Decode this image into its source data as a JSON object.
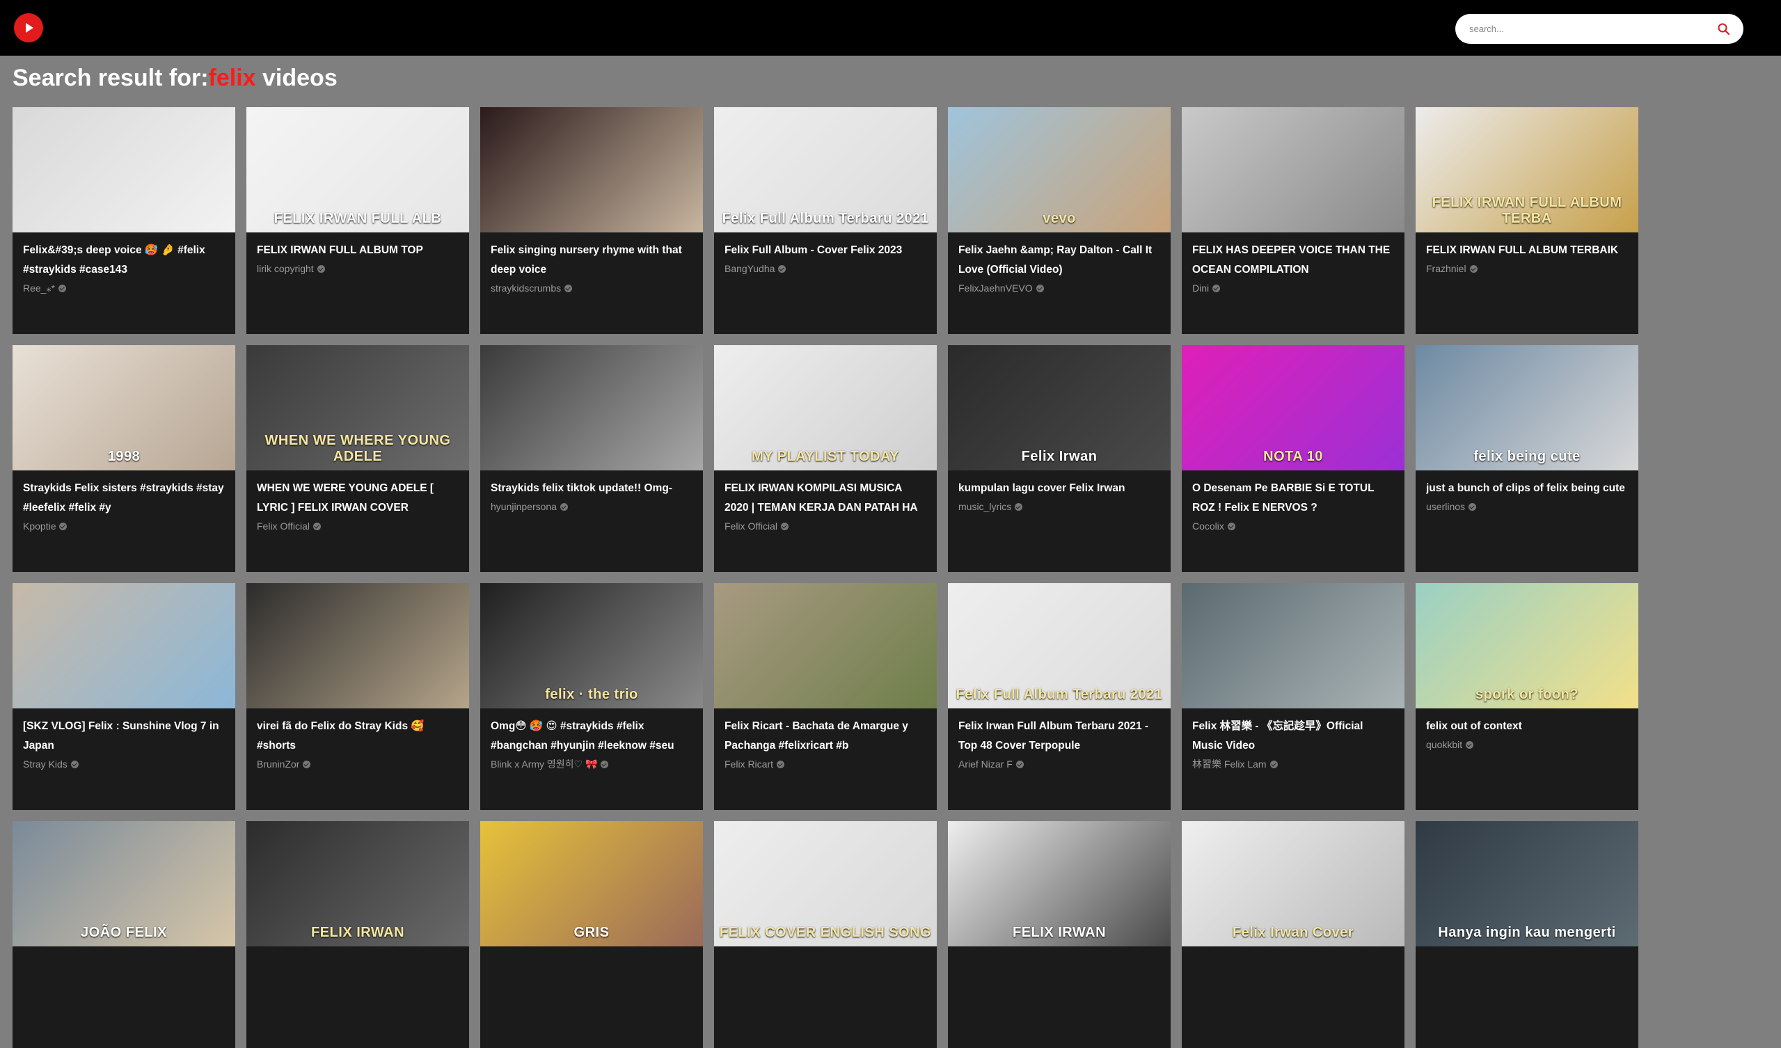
{
  "header": {
    "logo_icon": "play-logo-icon",
    "search_placeholder": "search...",
    "search_icon": "search-icon"
  },
  "heading": {
    "prefix": "Search result for:",
    "query": "felix",
    "suffix": " videos"
  },
  "videos": [
    {
      "title": "Felix&#39;s deep voice 🥵 🤌 #felix #straykids #case143",
      "channel": "Ree_⁎*",
      "thumb_colors": [
        "#d9d9d9",
        "#f2f2f2"
      ]
    },
    {
      "title": "FELIX IRWAN FULL ALBUM TOP",
      "channel": "lirik copyright",
      "thumb_colors": [
        "#f4f4f4",
        "#e6e6e6"
      ],
      "thumb_text": "FELIX IRWAN FULL ALB"
    },
    {
      "title": "Felix singing nursery rhyme with that deep voice",
      "channel": "straykidscrumbs",
      "thumb_colors": [
        "#2a1a1a",
        "#c8b6a0"
      ]
    },
    {
      "title": "Felix Full Album - Cover Felix 2023",
      "channel": "BangYudha",
      "thumb_colors": [
        "#eeeeee",
        "#dcdcdc"
      ],
      "thumb_text": "Felix Full Album Terbaru 2021"
    },
    {
      "title": "Felix Jaehn &amp; Ray Dalton - Call It Love (Official Video)",
      "channel": "FelixJaehnVEVO",
      "thumb_colors": [
        "#9fc4dc",
        "#c9a37a"
      ],
      "thumb_text": "vevo"
    },
    {
      "title": "FELIX HAS DEEPER VOICE THAN THE OCEAN COMPILATION",
      "channel": "Dini",
      "thumb_colors": [
        "#c9c9c9",
        "#8a8a8a"
      ]
    },
    {
      "title": "FELIX IRWAN FULL ALBUM TERBAIK",
      "channel": "Frazhniel",
      "thumb_colors": [
        "#ececec",
        "#c7a04a"
      ],
      "thumb_text": "FELIX IRWAN FULL ALBUM TERBA"
    },
    {
      "title": "Straykids Felix sisters #straykids #stay #leefelix #felix #y",
      "channel": "Kpoptie",
      "thumb_colors": [
        "#e8e0d6",
        "#b7a693"
      ],
      "thumb_text": "1998"
    },
    {
      "title": "WHEN WE WERE YOUNG ADELE [ LYRIC ] FELIX IRWAN COVER",
      "channel": "Felix Official",
      "thumb_colors": [
        "#3a3a3a",
        "#6d6d6d"
      ],
      "thumb_text": "WHEN WE WHERE YOUNG ADELE"
    },
    {
      "title": "Straykids felix tiktok update!! Omg-",
      "channel": "hyunjinpersona",
      "thumb_colors": [
        "#3b3b3b",
        "#a8a8a8"
      ]
    },
    {
      "title": "FELIX IRWAN KOMPILASI MUSICA 2020 | TEMAN KERJA DAN PATAH HA",
      "channel": "Felix Official",
      "thumb_colors": [
        "#eeeeee",
        "#cfcfcf"
      ],
      "thumb_text": "MY PLAYLIST TODAY"
    },
    {
      "title": "kumpulan lagu cover Felix Irwan",
      "channel": "music_lyrics",
      "thumb_colors": [
        "#2a2a2a",
        "#4a4a4a"
      ],
      "thumb_text": "Felix Irwan"
    },
    {
      "title": "O Desenam Pe BARBIE Si E TOTUL ROZ ! Felix E NERVOS ?",
      "channel": "Cocolix",
      "thumb_colors": [
        "#e01fb8",
        "#9b30d6"
      ],
      "thumb_text": "NOTA 10"
    },
    {
      "title": "just a bunch of clips of felix being cute",
      "channel": "userlinos",
      "thumb_colors": [
        "#6d8aa3",
        "#d8d8d8"
      ],
      "thumb_text": "felix being cute"
    },
    {
      "title": "[SKZ VLOG] Felix : Sunshine Vlog 7 in Japan",
      "channel": "Stray Kids",
      "thumb_colors": [
        "#c7b9a8",
        "#8cb7d8"
      ]
    },
    {
      "title": "virei fã do Felix do Stray Kids 🥰 #shorts",
      "channel": "BruninZor",
      "thumb_colors": [
        "#2c2c2c",
        "#b5a58a"
      ]
    },
    {
      "title": "Omg😳 🥵 😍 #straykids #felix #bangchan #hyunjin #leeknow #seu",
      "channel": "Blink x Army 영원히♡ 🎀",
      "thumb_colors": [
        "#1f1f1f",
        "#8a8a8a"
      ],
      "thumb_text": "felix · the trio"
    },
    {
      "title": "Felix Ricart - Bachata de Amargue y Pachanga #felixricart #b",
      "channel": "Felix Ricart",
      "thumb_colors": [
        "#a89a82",
        "#6f7f4a"
      ]
    },
    {
      "title": "Felix Irwan Full Album Terbaru 2021 - Top 48 Cover Terpopule",
      "channel": "Arief Nizar F",
      "thumb_colors": [
        "#eeeeee",
        "#dcdcdc"
      ],
      "thumb_text": "Felix Full Album Terbaru 2021"
    },
    {
      "title": "Felix 林習樂 - 《忘記趁早》Official Music Video",
      "channel": "林習樂 Felix Lam",
      "thumb_colors": [
        "#5b6a70",
        "#aab4b6"
      ]
    },
    {
      "title": "felix out of context",
      "channel": "quokkbit",
      "thumb_colors": [
        "#9ad0c4",
        "#f2e08a"
      ],
      "thumb_text": "spork or foon?"
    },
    {
      "title": "",
      "channel": "",
      "thumb_colors": [
        "#7a8a9a",
        "#d6c6a8"
      ],
      "thumb_text": "JOÃO FELIX"
    },
    {
      "title": "",
      "channel": "",
      "thumb_colors": [
        "#2c2c2c",
        "#6a6a6a"
      ],
      "thumb_text": "FELIX IRWAN"
    },
    {
      "title": "",
      "channel": "",
      "thumb_colors": [
        "#e6c23a",
        "#9a6a5a"
      ],
      "thumb_text": "GRIS"
    },
    {
      "title": "",
      "channel": "",
      "thumb_colors": [
        "#eeeeee",
        "#d8d8d8"
      ],
      "thumb_text": "FELIX COVER ENGLISH SONG"
    },
    {
      "title": "",
      "channel": "",
      "thumb_colors": [
        "#eeeeee",
        "#4a4a4a"
      ],
      "thumb_text": "FELIX IRWAN"
    },
    {
      "title": "",
      "channel": "",
      "thumb_colors": [
        "#efefef",
        "#b9b9b9"
      ],
      "thumb_text": "Felix Irwan Cover"
    },
    {
      "title": "",
      "channel": "",
      "thumb_colors": [
        "#2f3a44",
        "#5d6b73"
      ],
      "thumb_text": "Hanya ingin kau mengerti"
    }
  ]
}
